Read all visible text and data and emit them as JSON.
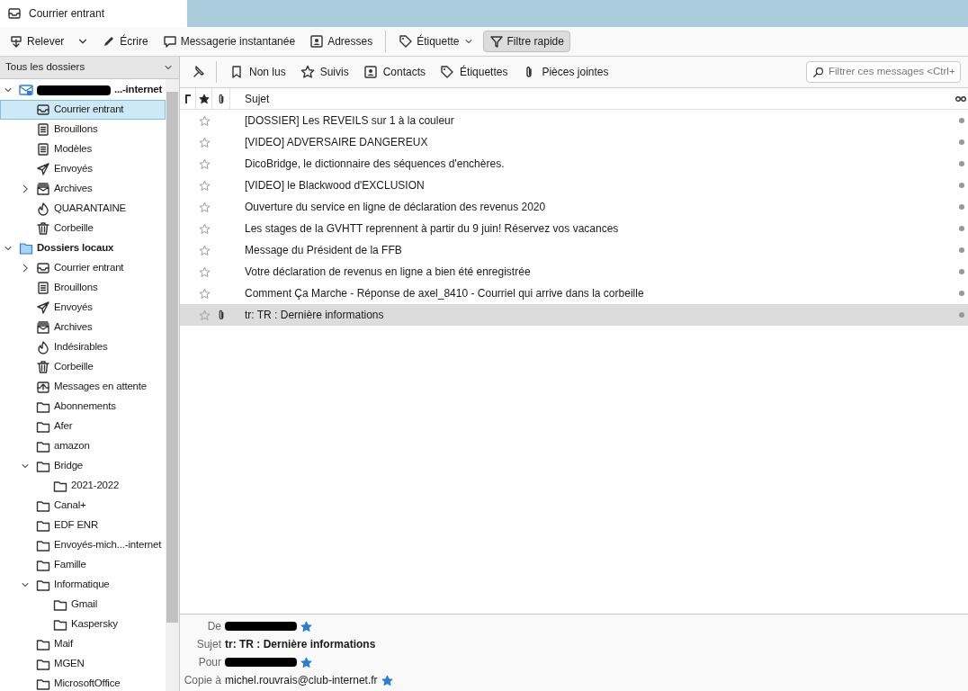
{
  "tabs": [
    {
      "label": "Courrier entrant",
      "selected": true
    }
  ],
  "toolbar": [
    {
      "label": "Relever",
      "dropdown": true,
      "pressed": false
    },
    {
      "label": "Écrire",
      "dropdown": false,
      "pressed": false
    },
    {
      "label": "Messagerie instantanée",
      "dropdown": false,
      "pressed": false
    },
    {
      "label": "Adresses",
      "dropdown": false,
      "pressed": false
    },
    {
      "label": "Étiquette",
      "dropdown": true,
      "pressed": false
    },
    {
      "label": "Filtre rapide",
      "dropdown": false,
      "pressed": true
    }
  ],
  "folder_pane": {
    "header": "Tous les dossiers",
    "tree": [
      {
        "label": "...-internet",
        "kind": "account",
        "expanded": true,
        "selected": false,
        "children": [
          {
            "label": "Courrier entrant",
            "kind": "inbox",
            "selected": true
          },
          {
            "label": "Brouillons",
            "kind": "drafts",
            "selected": false
          },
          {
            "label": "Modèles",
            "kind": "drafts",
            "selected": false
          },
          {
            "label": "Envoyés",
            "kind": "sent",
            "selected": false
          },
          {
            "label": "Archives",
            "kind": "archive",
            "expanded": false,
            "selected": false
          },
          {
            "label": "QUARANTAINE",
            "kind": "junk",
            "selected": false
          },
          {
            "label": "Corbeille",
            "kind": "trash",
            "selected": false
          }
        ]
      },
      {
        "label": "Dossiers locaux",
        "kind": "local",
        "expanded": true,
        "selected": false,
        "children": [
          {
            "label": "Courrier entrant",
            "kind": "inbox",
            "expanded": false,
            "selected": false
          },
          {
            "label": "Brouillons",
            "kind": "drafts",
            "selected": false
          },
          {
            "label": "Envoyés",
            "kind": "sent",
            "selected": false
          },
          {
            "label": "Archives",
            "kind": "archive",
            "selected": false
          },
          {
            "label": "Indésirables",
            "kind": "junk",
            "selected": false
          },
          {
            "label": "Corbeille",
            "kind": "trash",
            "selected": false
          },
          {
            "label": "Messages en attente",
            "kind": "outbox",
            "selected": false
          },
          {
            "label": "Abonnements",
            "kind": "folder",
            "selected": false
          },
          {
            "label": "Afer",
            "kind": "folder",
            "selected": false
          },
          {
            "label": "amazon",
            "kind": "folder",
            "selected": false
          },
          {
            "label": "Bridge",
            "kind": "folder",
            "expanded": true,
            "selected": false,
            "children": [
              {
                "label": "2021-2022",
                "kind": "folder",
                "selected": false
              }
            ]
          },
          {
            "label": "Canal+",
            "kind": "folder",
            "selected": false
          },
          {
            "label": "EDF ENR",
            "kind": "folder",
            "selected": false
          },
          {
            "label": "Envoyés-mich...-internet",
            "kind": "folder",
            "selected": false
          },
          {
            "label": "Famille",
            "kind": "folder",
            "selected": false
          },
          {
            "label": "Informatique",
            "kind": "folder",
            "expanded": true,
            "selected": false,
            "children": [
              {
                "label": "Gmail",
                "kind": "folder",
                "selected": false
              },
              {
                "label": "Kaspersky",
                "kind": "folder",
                "selected": false
              }
            ]
          },
          {
            "label": "Maif",
            "kind": "folder",
            "selected": false
          },
          {
            "label": "MGEN",
            "kind": "folder",
            "selected": false
          },
          {
            "label": "MicrosoftOffice",
            "kind": "folder",
            "selected": false
          }
        ]
      }
    ]
  },
  "quick_filter": {
    "buttons": [
      {
        "label": "Non lus"
      },
      {
        "label": "Suivis"
      },
      {
        "label": "Contacts"
      },
      {
        "label": "Étiquettes"
      },
      {
        "label": "Pièces jointes"
      }
    ],
    "search": {
      "placeholder": "Filtrer ces messages <Ctrl+"
    }
  },
  "message_list": {
    "columns": [
      "Sujet"
    ],
    "rows": [
      {
        "subject": "[DOSSIER] Les REVEILS sur 1 à la couleur",
        "starred": false,
        "attachment": false,
        "selected": false
      },
      {
        "subject": "[VIDEO] ADVERSAIRE DANGEREUX",
        "starred": false,
        "attachment": false,
        "selected": false
      },
      {
        "subject": "DicoBridge, le dictionnaire des séquences d'enchères.",
        "starred": false,
        "attachment": false,
        "selected": false
      },
      {
        "subject": "[VIDEO] le Blackwood d'EXCLUSION",
        "starred": false,
        "attachment": false,
        "selected": false
      },
      {
        "subject": "Ouverture du service en ligne de déclaration des revenus 2020",
        "starred": false,
        "attachment": false,
        "selected": false
      },
      {
        "subject": "Les stages de la GVHTT reprennent à partir du 9 juin! Réservez vos vacances",
        "starred": false,
        "attachment": false,
        "selected": false
      },
      {
        "subject": "Message du Président de la FFB",
        "starred": false,
        "attachment": false,
        "selected": false
      },
      {
        "subject": "Votre déclaration de revenus en ligne a bien été enregistrée",
        "starred": false,
        "attachment": false,
        "selected": false
      },
      {
        "subject": "Comment Ça Marche - Réponse de axel_8410 - Courriel qui arrive dans la corbeille",
        "starred": false,
        "attachment": false,
        "selected": false
      },
      {
        "subject": "tr: TR : Dernière informations",
        "starred": false,
        "attachment": true,
        "selected": true
      }
    ]
  },
  "message_header": [
    {
      "label": "De",
      "redacted": true
    },
    {
      "label": "Sujet",
      "value": "tr: TR : Dernière informations",
      "redacted": false
    },
    {
      "label": "Pour",
      "redacted": true
    },
    {
      "label": "Copie à",
      "value": "michel.rouvrais@club-internet.fr",
      "redacted": false
    }
  ]
}
